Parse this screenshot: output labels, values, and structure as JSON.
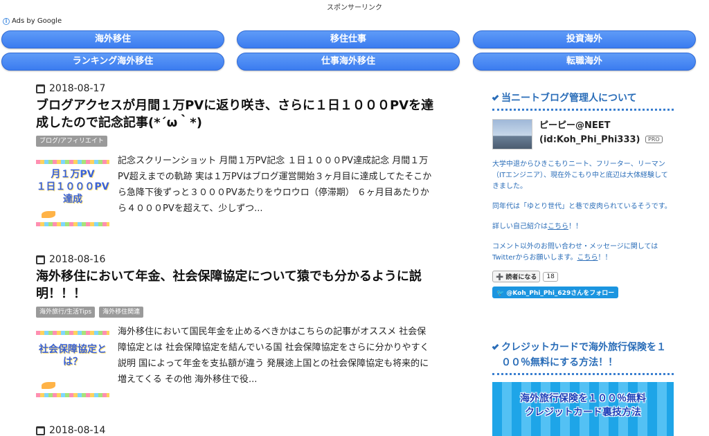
{
  "sponsor_label": "スポンサーリンク",
  "ads_label": "Ads by Google",
  "ad_links": [
    "海外移住",
    "移住仕事",
    "投資海外",
    "ランキング海外移住",
    "仕事海外移住",
    "転職海外"
  ],
  "posts": [
    {
      "date": "2018-08-17",
      "title": "ブログアクセスが月間１万PVに返り咲き、さらに１日１０００PVを達成したので記念記事(*´ω｀*)",
      "tags": [
        "ブログ/アフィリエイト"
      ],
      "thumb_text": "月１万PV\n１日１０００PV\n達成",
      "excerpt": "記念スクリーンショット 月間１万PV記念 １日１０００PV達成記念 月間１万PV超えまでの軌跡 実は１万PVはブログ運営開始３ヶ月目に達成してたそこから急降下後ずっと３０００PVあたりをウロウロ（停滞期） ６ヶ月目あたりから４０００PVを超えて、少しずつ..."
    },
    {
      "date": "2018-08-16",
      "title": "海外移住において年金、社会保障協定について猿でも分かるように説明！！！",
      "tags": [
        "海外旅行/生活Tips",
        "海外移住関連"
      ],
      "thumb_text": "社会保障協定とは？",
      "excerpt": "海外移住において国民年金を止めるべきかはこちらの記事がオススメ 社会保障協定とは 社会保障協定を結んでいる国 社会保障協定をさらに分かりやすく説明 国によって年金を支払額が違う 発展途上国との社会保障協定も将来的に増えてくる その他 海外移住で役..."
    },
    {
      "date": "2018-08-14"
    }
  ],
  "sidebar": {
    "about_heading": "当ニートブログ管理人について",
    "profile_name": "ピーピー@NEET",
    "profile_id": "(id:Koh_Phi_Phi333)",
    "pro_badge": "PRO",
    "bio1": "大学中退からひきこもりニート、フリーター、リーマン（ITエンジニア）、現在外こもり中と底辺は大体経験してきました。",
    "bio2": "同年代は「ゆとり世代」と巷で皮肉られているそうです。",
    "bio3_pre": " 詳しい自己紹介は",
    "bio3_link": "こちら",
    "bio3_post": "！！",
    "bio4_pre": " コメント以外のお問い合わせ・メッセージに関してはTwitterからお願いします。",
    "bio4_link": "こちら",
    "bio4_post": "！！",
    "reader_button": "➕ 読者になる",
    "reader_count": "18",
    "twitter_button": "🐦 @Koh_Phi_Phi_629さんをフォロー",
    "card_heading": "クレジットカードで海外旅行保険を１００％無料にする方法！！",
    "banner_text": "海外旅行保険を１００％無料\nクレジットカード裏技方法"
  }
}
